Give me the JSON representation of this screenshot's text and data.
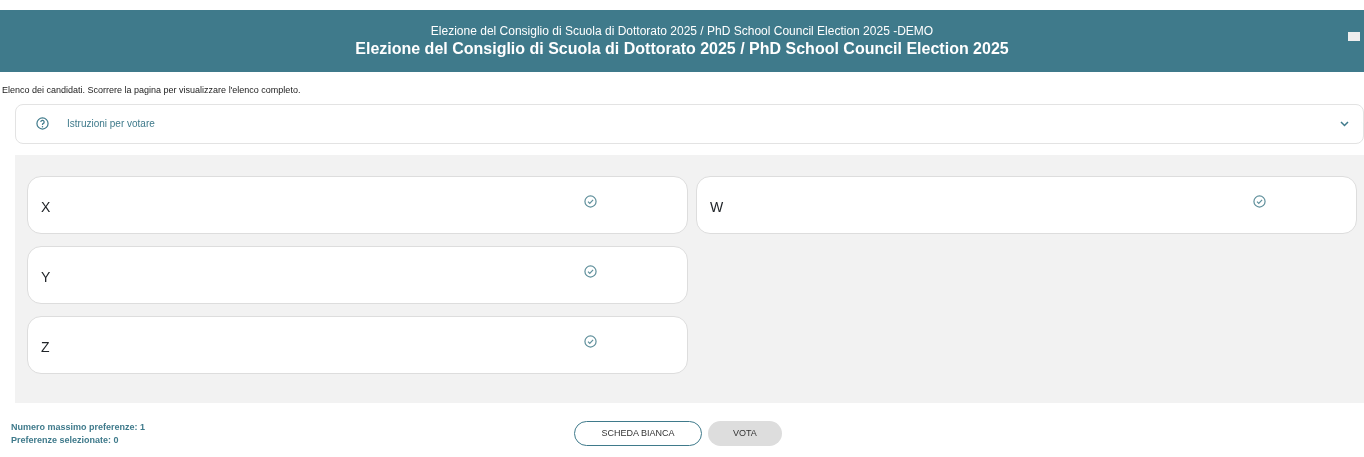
{
  "header": {
    "subtitle": "Elezione del Consiglio di Scuola di Dottorato 2025 / PhD School Council Election 2025 -DEMO",
    "title": "Elezione del Consiglio di Scuola di Dottorato 2025 / PhD School Council Election 2025"
  },
  "intro": "Elenco dei candidati. Scorrere la pagina per visualizzare l'elenco completo.",
  "instructions": {
    "label": "Istruzioni per votare",
    "expanded": false
  },
  "candidates": [
    {
      "name": "X",
      "selected": false
    },
    {
      "name": "Y",
      "selected": false
    },
    {
      "name": "Z",
      "selected": false
    },
    {
      "name": "W",
      "selected": false
    }
  ],
  "footer": {
    "max_preferences": "Numero massimo preferenze: 1",
    "selected_preferences": "Preferenze selezionate: 0"
  },
  "buttons": [
    {
      "label": "SCHEDA BIANCA",
      "disabled": false
    },
    {
      "label": "VOTA",
      "disabled": true
    }
  ]
}
